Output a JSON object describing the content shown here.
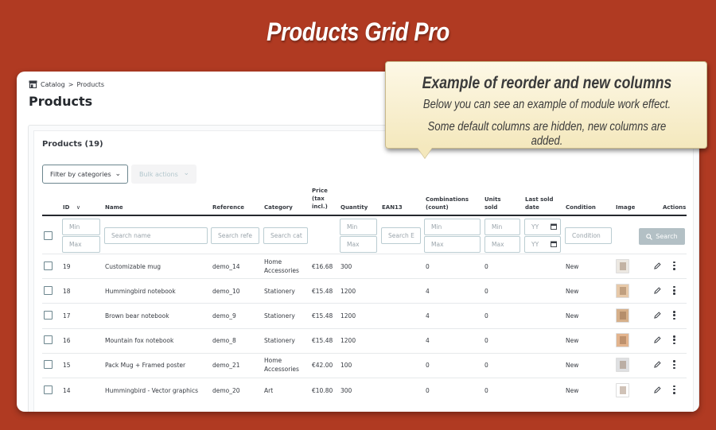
{
  "banner": {
    "title": "Products Grid Pro"
  },
  "callout": {
    "title": "Example of reorder and new columns",
    "line1": "Below you can see an example of module work effect.",
    "line2": "Some default columns are hidden, new columns are added."
  },
  "breadcrumb": {
    "parent": "Catalog",
    "separator": ">",
    "current": "Products"
  },
  "page_title": "Products",
  "grid": {
    "title": "Products (19)",
    "filter_button": "Filter by categories",
    "bulk_button": "Bulk actions",
    "columns": {
      "id": "ID",
      "name": "Name",
      "reference": "Reference",
      "category": "Category",
      "price_l1": "Price",
      "price_l2": "(tax",
      "price_l3": "incl.)",
      "quantity": "Quantity",
      "ean13": "EAN13",
      "combinations_l1": "Combinations",
      "combinations_l2": "(count)",
      "units_l1": "Units",
      "units_l2": "sold",
      "last_sold_l1": "Last sold",
      "last_sold_l2": "date",
      "condition": "Condition",
      "image": "Image",
      "actions": "Actions"
    },
    "sort_indicator": "∨",
    "filters": {
      "id_min": "Min",
      "id_max": "Max",
      "name": "Search name",
      "reference": "Search refe",
      "category": "Search cat",
      "qty_min": "Min",
      "qty_max": "Max",
      "ean13": "Search E",
      "comb_min": "Min",
      "comb_max": "Max",
      "units_min": "Min",
      "units_max": "Max",
      "date_from": "YY",
      "date_to": "YY",
      "condition": "Condition",
      "search_button": "Search"
    },
    "rows": [
      {
        "id": "19",
        "name": "Customizable mug",
        "reference": "demo_14",
        "category_l1": "Home",
        "category_l2": "Accessories",
        "price": "€16.68",
        "quantity": "300",
        "combinations": "0",
        "units_sold": "0",
        "condition": "New"
      },
      {
        "id": "18",
        "name": "Hummingbird notebook",
        "reference": "demo_10",
        "category_l1": "Stationery",
        "category_l2": "",
        "price": "€15.48",
        "quantity": "1200",
        "combinations": "4",
        "units_sold": "0",
        "condition": "New"
      },
      {
        "id": "17",
        "name": "Brown bear notebook",
        "reference": "demo_9",
        "category_l1": "Stationery",
        "category_l2": "",
        "price": "€15.48",
        "quantity": "1200",
        "combinations": "4",
        "units_sold": "0",
        "condition": "New"
      },
      {
        "id": "16",
        "name": "Mountain fox notebook",
        "reference": "demo_8",
        "category_l1": "Stationery",
        "category_l2": "",
        "price": "€15.48",
        "quantity": "1200",
        "combinations": "4",
        "units_sold": "0",
        "condition": "New"
      },
      {
        "id": "15",
        "name": "Pack Mug + Framed poster",
        "reference": "demo_21",
        "category_l1": "Home",
        "category_l2": "Accessories",
        "price": "€42.00",
        "quantity": "100",
        "combinations": "0",
        "units_sold": "0",
        "condition": "New"
      },
      {
        "id": "14",
        "name": "Hummingbird - Vector graphics",
        "reference": "demo_20",
        "category_l1": "Art",
        "category_l2": "",
        "price": "€10.80",
        "quantity": "300",
        "combinations": "0",
        "units_sold": "0",
        "condition": "New"
      }
    ]
  },
  "colors": {
    "background": "#b03a22",
    "callout": "#f4e8bd",
    "text": "#363a41",
    "search_button": "#b3c0c5"
  }
}
